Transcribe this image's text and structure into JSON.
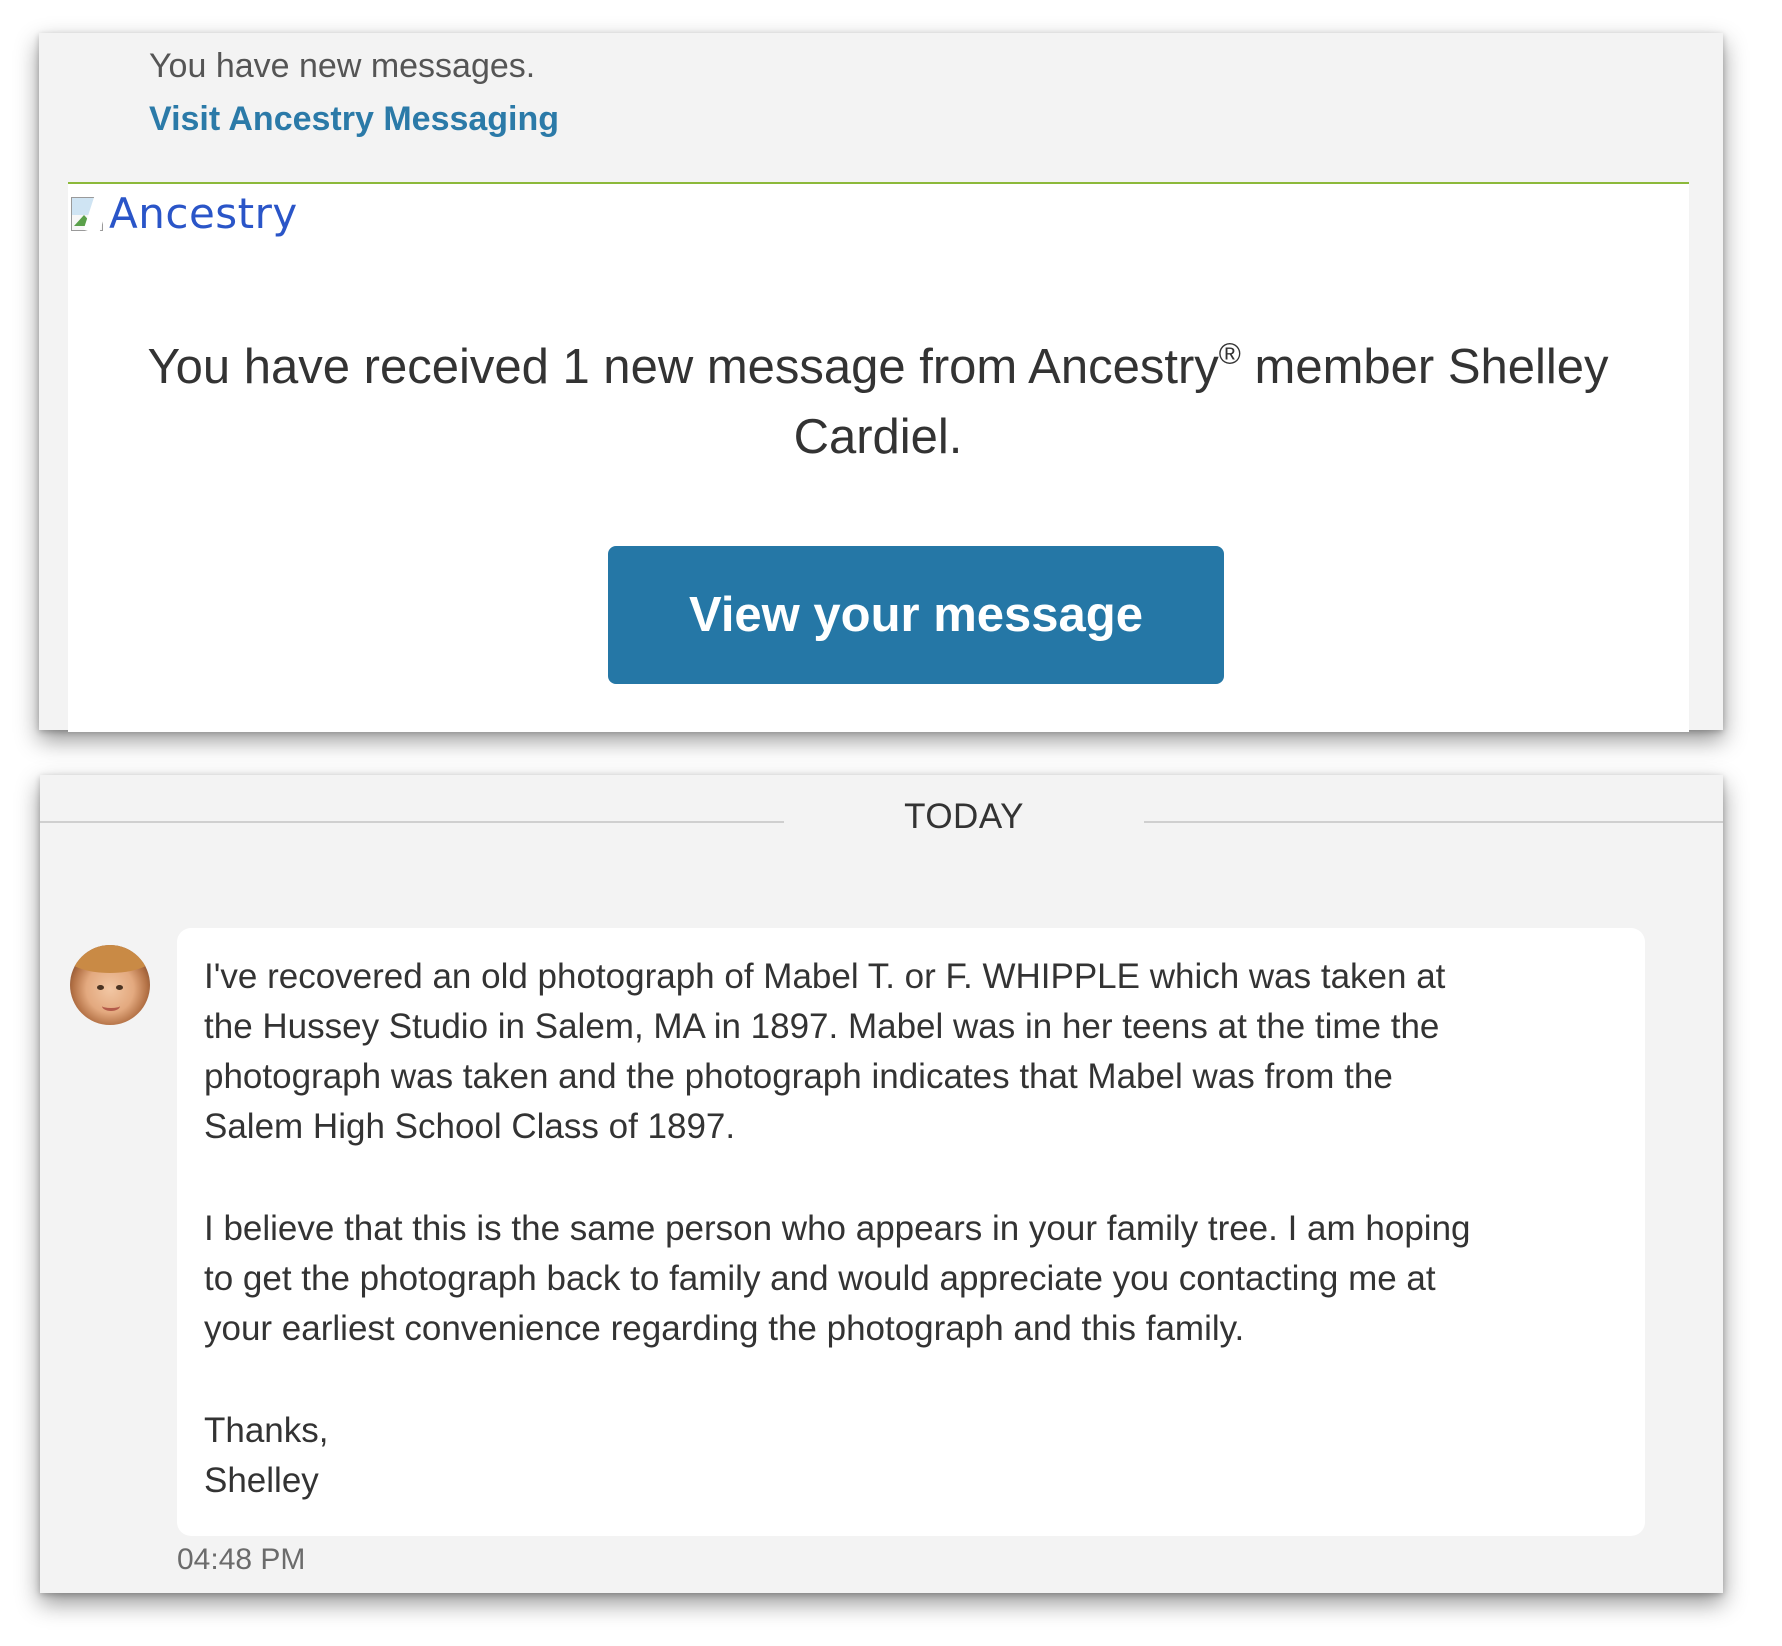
{
  "email": {
    "notice_text": "You have new messages.",
    "notice_link": "Visit Ancestry Messaging",
    "logo_alt": "Ancestry",
    "headline_before": "You have received 1 new message from Ancestry",
    "headline_registered": "®",
    "headline_after": " member Shelley Cardiel.",
    "cta_label": "View your message",
    "colors": {
      "link": "#2b7aa8",
      "button": "#2577a6",
      "rule": "#8cb93a"
    }
  },
  "chat": {
    "day_label": "TODAY",
    "sender_avatar_icon": "avatar",
    "message_paragraph_1": [
      "I've recovered an old photograph of Mabel T. or F. WHIPPLE which was taken at",
      "the Hussey Studio in Salem, MA in 1897. Mabel was in her teens at the time the",
      "photograph was taken and the photograph indicates that Mabel was from the",
      "Salem High School Class of 1897."
    ],
    "message_paragraph_2": [
      "I believe that this is the same person who appears in your family tree. I am hoping",
      "to get the photograph back to family and would appreciate you contacting me at",
      "your earliest convenience regarding the photograph and this family."
    ],
    "message_closing": [
      "Thanks,",
      "Shelley"
    ],
    "timestamp": "04:48 PM"
  }
}
